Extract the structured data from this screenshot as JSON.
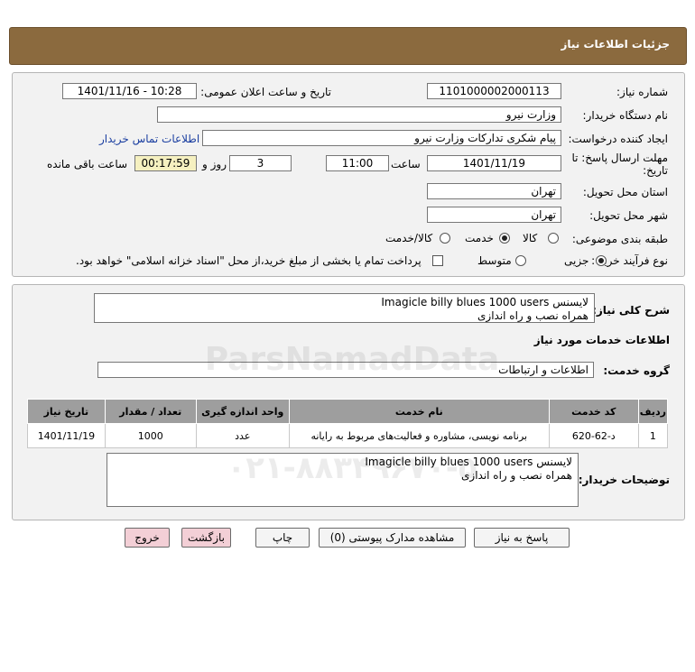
{
  "header": {
    "title": "جزئیات اطلاعات نیاز"
  },
  "form": {
    "need_number_label": "شماره نیاز:",
    "need_number": "1101000002000113",
    "announce_label": "تاریخ و ساعت اعلان عمومی:",
    "announce_value": "1401/11/16 - 10:28",
    "buyer_org_label": "نام دستگاه خریدار:",
    "buyer_org": "وزارت نیرو",
    "creator_label": "ایجاد کننده درخواست:",
    "creator": "پیام شکری تدارکات وزارت نیرو",
    "contact_link": "اطلاعات تماس خریدار",
    "deadline_label_1": "مهلت ارسال پاسخ: تا",
    "deadline_label_2": "تاریخ:",
    "deadline_date": "1401/11/19",
    "time_label": "ساعت",
    "deadline_time": "11:00",
    "days_value": "3",
    "days_label": "روز و",
    "remaining_value": "00:17:59",
    "remaining_label": "ساعت باقی مانده",
    "province_label": "استان محل تحویل:",
    "province": "تهران",
    "city_label": "شهر محل تحویل:",
    "city": "تهران",
    "category_label": "طبقه بندی موضوعی:",
    "category_options": [
      "کالا",
      "خدمت",
      "کالا/خدمت"
    ],
    "category_selected": "خدمت",
    "process_label": "نوع فرآیند خرید :",
    "process_options": [
      "جزیی",
      "متوسط"
    ],
    "process_selected": "جزیی",
    "payment_note": "پرداخت تمام یا بخشی از مبلغ خرید،از محل \"اسناد خزانه اسلامی\" خواهد بود."
  },
  "details": {
    "summary_label": "شرح کلی نیاز:",
    "summary_line1": "لایسنس Imagicle billy blues 1000 users",
    "summary_line2": "همراه نصب و راه اندازی",
    "services_heading": "اطلاعات خدمات مورد نیاز",
    "service_group_label": "گروه خدمت:",
    "service_group": "اطلاعات و ارتباطات",
    "table": {
      "headers": [
        "ردیف",
        "کد خدمت",
        "نام خدمت",
        "واحد اندازه گیری",
        "تعداد / مقدار",
        "تاریخ نیاز"
      ],
      "rows": [
        [
          "1",
          "د-62-620",
          "برنامه نویسی، مشاوره و فعالیت‌های مربوط به رایانه",
          "عدد",
          "1000",
          "1401/11/19"
        ]
      ]
    },
    "buyer_notes_label": "توضیحات خریدار:",
    "notes_line1": "لایسنس Imagicle billy blues 1000 users",
    "notes_line2": "همراه نصب و راه اندازی"
  },
  "buttons": {
    "reply": "پاسخ به نیاز",
    "attachments": "مشاهده مدارک پیوستی (0)",
    "print": "چاپ",
    "back": "بازگشت",
    "exit": "خروج"
  },
  "watermark": {
    "brand": "ParsNamadData",
    "phone": "۰۲۱-۸۸۳۴۹۶۷۰-۵"
  }
}
